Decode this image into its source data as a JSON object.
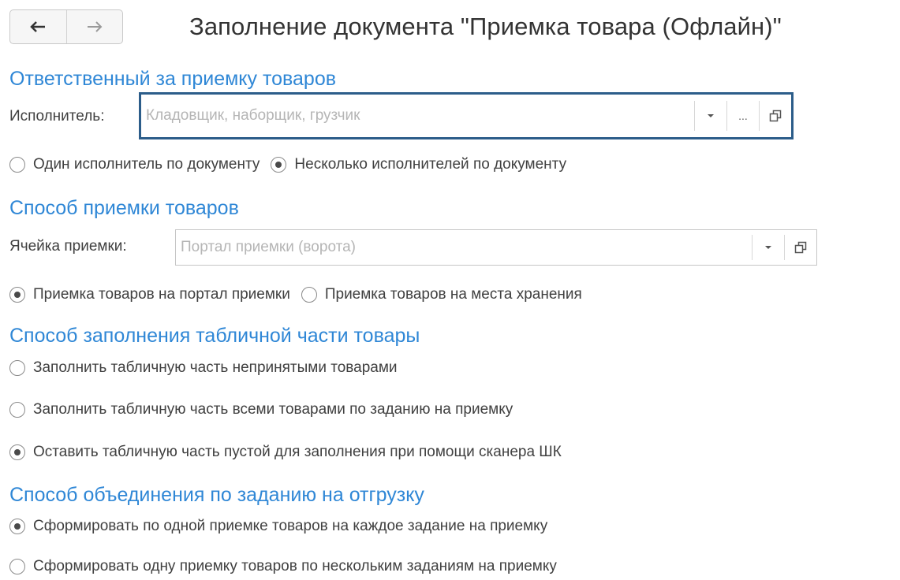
{
  "header": {
    "title": "Заполнение документа \"Приемка товара (Офлайн)\"",
    "back_icon": "arrow-left-icon",
    "forward_icon": "arrow-right-icon"
  },
  "sections": {
    "responsible": {
      "title": "Ответственный за приемку товаров",
      "executor_label": "Исполнитель:",
      "executor_placeholder": "Кладовщик, наборщик, грузчик",
      "dropdown_icon": "chevron-down-icon",
      "select_glyph": "...",
      "open_icon": "open-window-icon",
      "options": [
        {
          "label": "Один исполнитель по документу",
          "checked": false
        },
        {
          "label": "Несколько исполнителей по документу",
          "checked": true
        }
      ]
    },
    "method": {
      "title": "Способ приемки товаров",
      "cell_label": "Ячейка приемки:",
      "cell_placeholder": "Портал приемки (ворота)",
      "dropdown_icon": "chevron-down-icon",
      "open_icon": "open-window-icon",
      "options": [
        {
          "label": "Приемка товаров на портал приемки",
          "checked": true
        },
        {
          "label": "Приемка товаров на места хранения",
          "checked": false
        }
      ]
    },
    "fill": {
      "title": "Способ заполнения табличной части товары",
      "options": [
        {
          "label": "Заполнить табличную часть непринятыми товарами",
          "checked": false
        },
        {
          "label": "Заполнить табличную часть всеми товарами по заданию на приемку",
          "checked": false
        },
        {
          "label": "Оставить табличную часть пустой для заполнения при помощи сканера ШК",
          "checked": true
        }
      ]
    },
    "merge": {
      "title": "Способ объединения по заданию на отгрузку",
      "options": [
        {
          "label": "Сформировать по одной приемке товаров на каждое задание на приемку",
          "checked": true
        },
        {
          "label": "Сформировать одну приемку товаров по нескольким заданиям на приемку",
          "checked": false
        }
      ]
    }
  },
  "colors": {
    "section_title": "#2f87d6",
    "active_field_border": "#2c5d8a",
    "placeholder": "#b5b5b5"
  }
}
